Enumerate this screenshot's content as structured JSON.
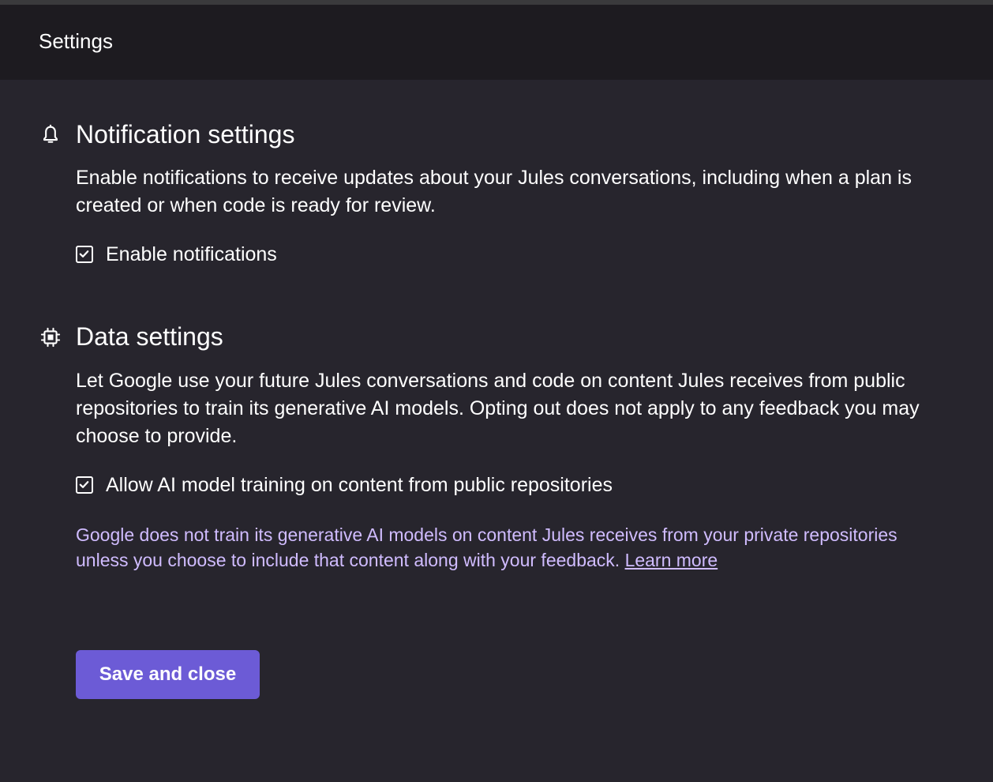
{
  "header": {
    "title": "Settings"
  },
  "notification_settings": {
    "icon": "bell-icon",
    "title": "Notification settings",
    "description": "Enable notifications to receive updates about your Jules conversations, including when a plan is created or when code is ready for review.",
    "checkbox": {
      "label": "Enable notifications",
      "checked": true
    }
  },
  "data_settings": {
    "icon": "chip-icon",
    "title": "Data settings",
    "description": "Let Google use your future Jules conversations and code on content Jules receives from public repositories to train its generative AI models. Opting out does not apply to any feedback you may choose to provide.",
    "checkbox": {
      "label": "Allow AI model training on content from public repositories",
      "checked": true
    },
    "note": "Google does not train its generative AI models on content Jules receives from your private repositories unless you choose to include that content along with your feedback.",
    "learn_more": "Learn more"
  },
  "actions": {
    "save_label": "Save and close"
  },
  "colors": {
    "header_bg": "#1d1b20",
    "content_bg": "#27252d",
    "accent": "#6c5bd6",
    "note_text": "#d0bcff"
  }
}
